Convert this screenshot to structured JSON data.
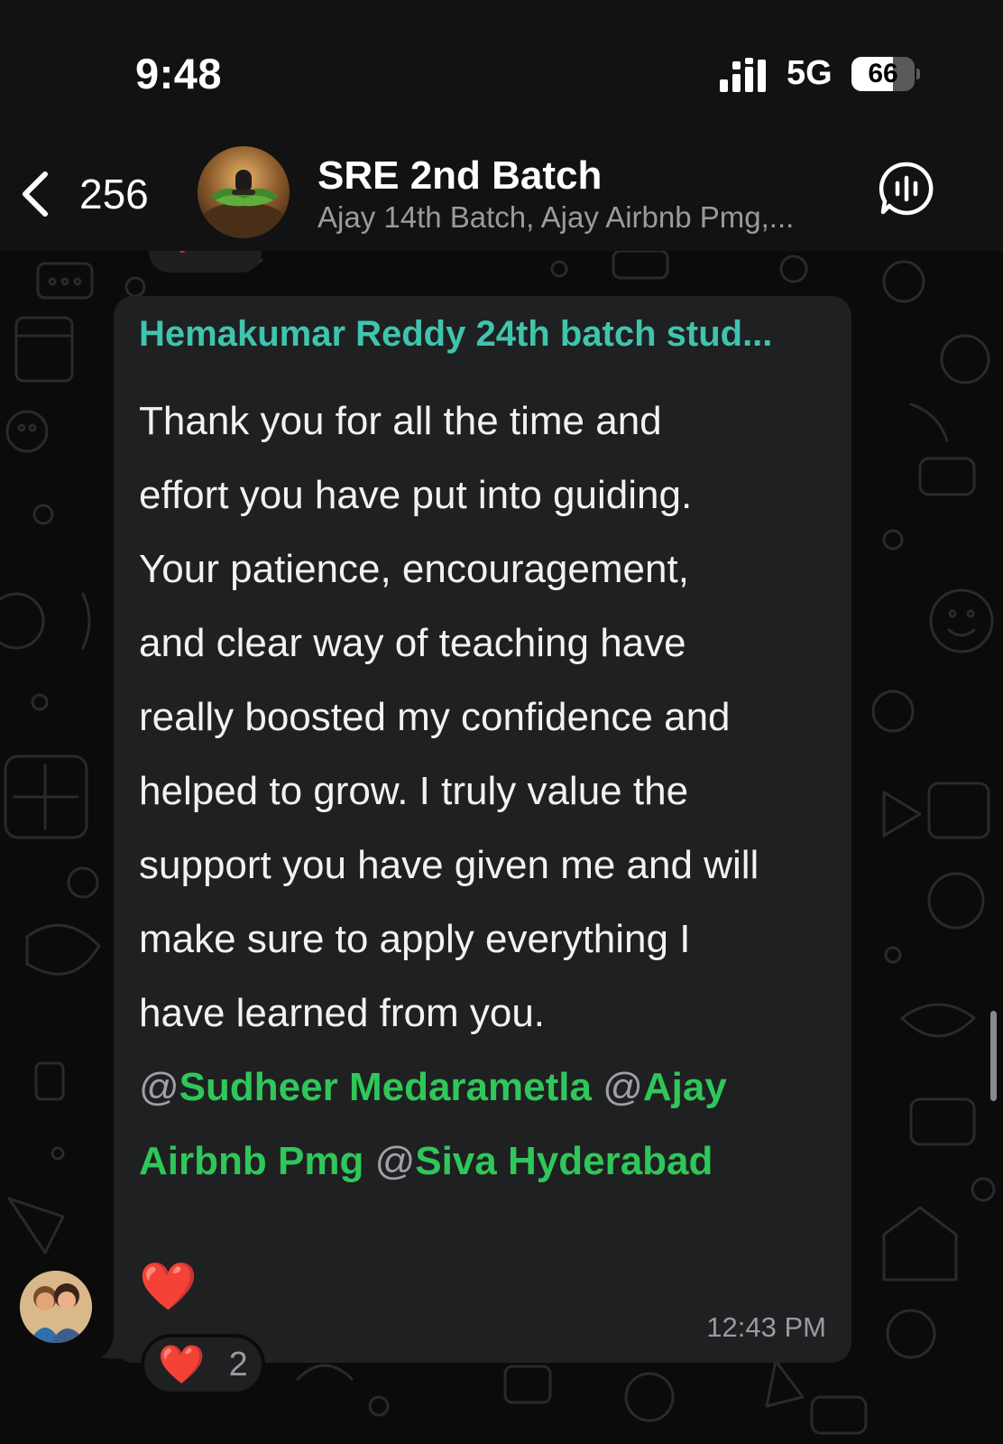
{
  "status_bar": {
    "time": "9:48",
    "network": "5G",
    "battery": "66",
    "battery_level": 0.66,
    "icons": [
      "signal-bars-icon",
      "battery-icon"
    ]
  },
  "header": {
    "back_count": "256",
    "title": "SRE 2nd Batch",
    "members": "Ajay 14th Batch, Ajay Airbnb Pmg,...",
    "icons": [
      "chevron-left-icon",
      "group-avatar",
      "voice-chat-icon"
    ]
  },
  "message": {
    "sender": "Hemakumar Reddy 24th batch stud...",
    "lines": [
      "Thank you for all the time and",
      "effort you have put into guiding.",
      "Your patience, encouragement,",
      "and clear way of teaching have",
      "really boosted my confidence and",
      "helped to grow. I truly value the",
      "support you have given me and will",
      "make sure to apply everything I",
      "have learned from you."
    ],
    "mentions": [
      {
        "at": "@",
        "name": "Sudheer Medarametla"
      },
      {
        "at": "@",
        "name": "Ajay Airbnb Pmg"
      },
      {
        "at": "@",
        "name": "Siva Hyderabad"
      }
    ],
    "mention_line_1": {
      "m1_at": "@",
      "m1_name": "Sudheer Medarametla",
      "m2_at": "@",
      "m2_name_part": "Ajay"
    },
    "mention_line_2": {
      "m2_name_rest": "Airbnb Pmg",
      "m3_at": "@",
      "m3_name": "Siva Hyderabad"
    },
    "emoji": "❤️",
    "time": "12:43 PM"
  },
  "reaction": {
    "emoji": "❤️",
    "count": "2"
  },
  "colors": {
    "background": "#0b0b0c",
    "bubble": "#1f2021",
    "sender_name": "#3fc4ae",
    "mention": "#2fc75a",
    "heart": "#e4202f",
    "muted_text": "#9a9a9f"
  }
}
